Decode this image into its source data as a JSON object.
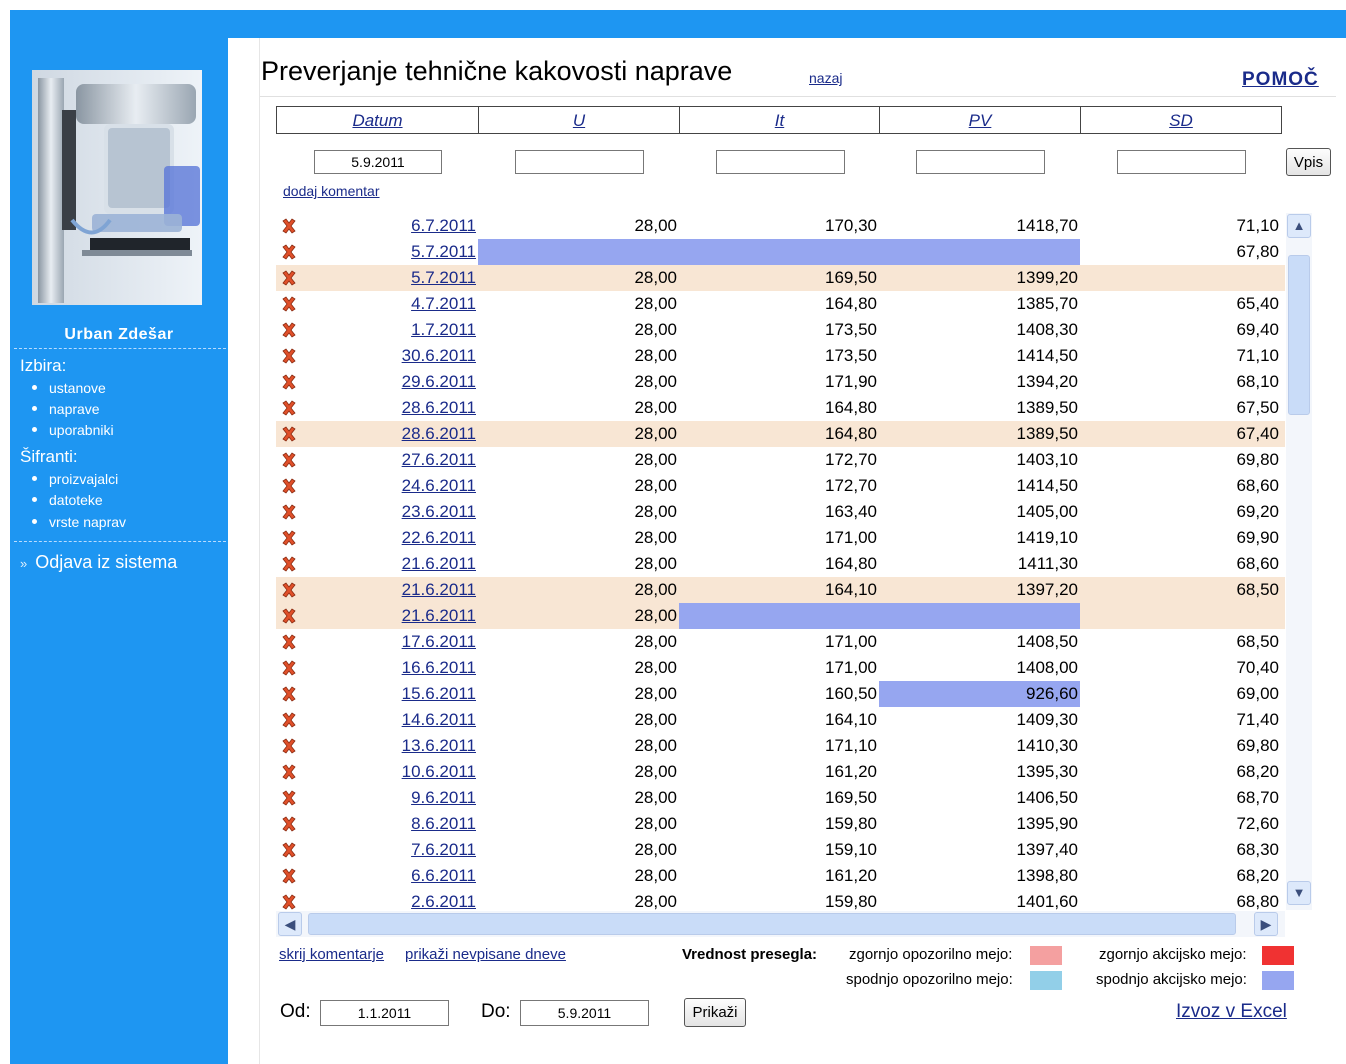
{
  "sidebar": {
    "user_name": "Urban Zdešar",
    "section_izbira": "Izbira:",
    "izbira_items": [
      "ustanove",
      "naprave",
      "uporabniki"
    ],
    "section_sifranti": "Šifranti:",
    "sifranti_items": [
      "proizvajalci",
      "datoteke",
      "vrste naprav"
    ],
    "logout_arrows": "»",
    "logout_label": "Odjava iz sistema"
  },
  "header": {
    "title": "Preverjanje tehnične kakovosti naprave",
    "back_link": "nazaj",
    "help_link": "POMOČ"
  },
  "table": {
    "columns": [
      "Datum",
      "U",
      "It",
      "PV",
      "SD"
    ],
    "new_entry": {
      "date": "5.9.2011",
      "u": "",
      "it": "",
      "pv": "",
      "sd": ""
    },
    "submit_label": "Vpis",
    "add_comment_link": "dodaj komentar",
    "rows": [
      {
        "date": "6.7.2011",
        "u": "28,00",
        "it": "170,30",
        "pv": "1418,70",
        "sd": "71,10"
      },
      {
        "date": "5.7.2011",
        "u": "",
        "it": "",
        "pv": "",
        "sd": "67,80",
        "u_flag": "blue",
        "it_flag": "blue",
        "pv_flag": "blue"
      },
      {
        "date": "5.7.2011",
        "u": "28,00",
        "it": "169,50",
        "pv": "1399,20",
        "sd": "",
        "highlight": true
      },
      {
        "date": "4.7.2011",
        "u": "28,00",
        "it": "164,80",
        "pv": "1385,70",
        "sd": "65,40"
      },
      {
        "date": "1.7.2011",
        "u": "28,00",
        "it": "173,50",
        "pv": "1408,30",
        "sd": "69,40"
      },
      {
        "date": "30.6.2011",
        "u": "28,00",
        "it": "173,50",
        "pv": "1414,50",
        "sd": "71,10"
      },
      {
        "date": "29.6.2011",
        "u": "28,00",
        "it": "171,90",
        "pv": "1394,20",
        "sd": "68,10"
      },
      {
        "date": "28.6.2011",
        "u": "28,00",
        "it": "164,80",
        "pv": "1389,50",
        "sd": "67,50"
      },
      {
        "date": "28.6.2011",
        "u": "28,00",
        "it": "164,80",
        "pv": "1389,50",
        "sd": "67,40",
        "highlight": true
      },
      {
        "date": "27.6.2011",
        "u": "28,00",
        "it": "172,70",
        "pv": "1403,10",
        "sd": "69,80"
      },
      {
        "date": "24.6.2011",
        "u": "28,00",
        "it": "172,70",
        "pv": "1414,50",
        "sd": "68,60"
      },
      {
        "date": "23.6.2011",
        "u": "28,00",
        "it": "163,40",
        "pv": "1405,00",
        "sd": "69,20"
      },
      {
        "date": "22.6.2011",
        "u": "28,00",
        "it": "171,00",
        "pv": "1419,10",
        "sd": "69,90"
      },
      {
        "date": "21.6.2011",
        "u": "28,00",
        "it": "164,80",
        "pv": "1411,30",
        "sd": "68,60"
      },
      {
        "date": "21.6.2011",
        "u": "28,00",
        "it": "164,10",
        "pv": "1397,20",
        "sd": "68,50",
        "highlight": true
      },
      {
        "date": "21.6.2011",
        "u": "28,00",
        "it": "",
        "pv": "",
        "sd": "",
        "highlight": true,
        "it_flag": "blue",
        "pv_flag": "blue"
      },
      {
        "date": "17.6.2011",
        "u": "28,00",
        "it": "171,00",
        "pv": "1408,50",
        "sd": "68,50"
      },
      {
        "date": "16.6.2011",
        "u": "28,00",
        "it": "171,00",
        "pv": "1408,00",
        "sd": "70,40"
      },
      {
        "date": "15.6.2011",
        "u": "28,00",
        "it": "160,50",
        "pv": "926,60",
        "sd": "69,00",
        "pv_flag": "blue"
      },
      {
        "date": "14.6.2011",
        "u": "28,00",
        "it": "164,10",
        "pv": "1409,30",
        "sd": "71,40"
      },
      {
        "date": "13.6.2011",
        "u": "28,00",
        "it": "171,10",
        "pv": "1410,30",
        "sd": "69,80"
      },
      {
        "date": "10.6.2011",
        "u": "28,00",
        "it": "161,20",
        "pv": "1395,30",
        "sd": "68,20"
      },
      {
        "date": "9.6.2011",
        "u": "28,00",
        "it": "169,50",
        "pv": "1406,50",
        "sd": "68,70"
      },
      {
        "date": "8.6.2011",
        "u": "28,00",
        "it": "159,80",
        "pv": "1395,90",
        "sd": "72,60"
      },
      {
        "date": "7.6.2011",
        "u": "28,00",
        "it": "159,10",
        "pv": "1397,40",
        "sd": "68,30"
      },
      {
        "date": "6.6.2011",
        "u": "28,00",
        "it": "161,20",
        "pv": "1398,80",
        "sd": "68,20"
      },
      {
        "date": "2.6.2011",
        "u": "28,00",
        "it": "159,80",
        "pv": "1401,60",
        "sd": "68,80"
      }
    ]
  },
  "footer": {
    "hide_comments": "skrij komentarje",
    "show_unwritten": "prikaži nevpisane dneve",
    "legend_title": "Vrednost presegla:",
    "legend": [
      {
        "label": "zgornjo opozorilno mejo:",
        "color": "#f4a0a0"
      },
      {
        "label": "zgornjo akcijsko mejo:",
        "color": "#f03232"
      },
      {
        "label": "spodnjo opozorilno mejo:",
        "color": "#92cfe8"
      },
      {
        "label": "spodnjo akcijsko mejo:",
        "color": "#96a6f0"
      }
    ],
    "from_label": "Od:",
    "from_value": "1.1.2011",
    "to_label": "Do:",
    "to_value": "5.9.2011",
    "show_button": "Prikaži",
    "export_link": "Izvoz v Excel"
  },
  "colors": {
    "sidebar": "#1e96f2",
    "link": "#1a2b8a",
    "highlight_row": "#f8e6d4",
    "flag_blue": "#96a6f0"
  },
  "icons": {
    "delete": "x-delete-icon",
    "scroll_up": "chevron-up-icon",
    "scroll_down": "chevron-down-icon",
    "scroll_left": "chevron-left-icon",
    "scroll_right": "chevron-right-icon"
  }
}
